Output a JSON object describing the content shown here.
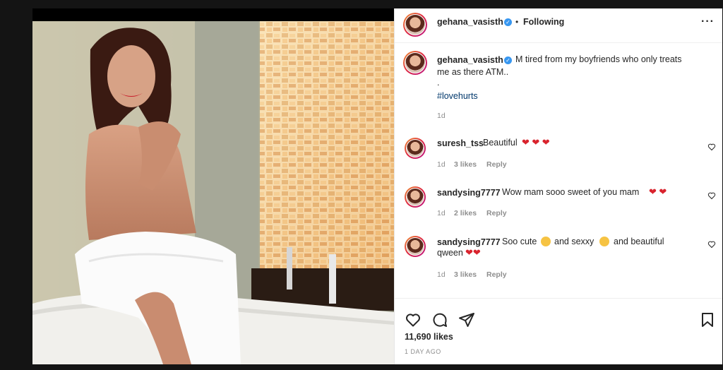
{
  "post": {
    "username": "gehana_vasisth",
    "follow_status": "Following",
    "caption": "M tired from my boyfriends who only treats me as there ATM..",
    "caption_line1": "M tired from my boyfriends who only treats",
    "caption_line2": "me as there ATM..",
    "caption_dot": ".",
    "hashtag": "#lovehurts",
    "caption_time": "1d",
    "likes": "11,690 likes",
    "posted": "1 DAY AGO"
  },
  "comments": [
    {
      "username": "suresh_tss",
      "text": "Beautiful",
      "time": "1d",
      "likes": "3 likes",
      "reply": "Reply"
    },
    {
      "username": "sandysing7777",
      "text": "Wow mam sooo sweet of you mam",
      "time": "1d",
      "likes": "2 likes",
      "reply": "Reply"
    },
    {
      "username": "sandysing7777",
      "text_a": "Soo cute",
      "text_b": "and sexxy",
      "text_c": "and beautiful",
      "text_d": "qween",
      "time": "1d",
      "likes": "3 likes",
      "reply": "Reply"
    }
  ],
  "icons": {
    "verified": "verified-badge-icon",
    "more": "more-options-icon",
    "like": "heart-icon",
    "comment": "comment-icon",
    "share": "send-icon",
    "save": "bookmark-icon"
  },
  "colors": {
    "background": "#141414",
    "verified": "#3897f0",
    "hashtag": "#00376b",
    "heart": "#d9232d"
  }
}
